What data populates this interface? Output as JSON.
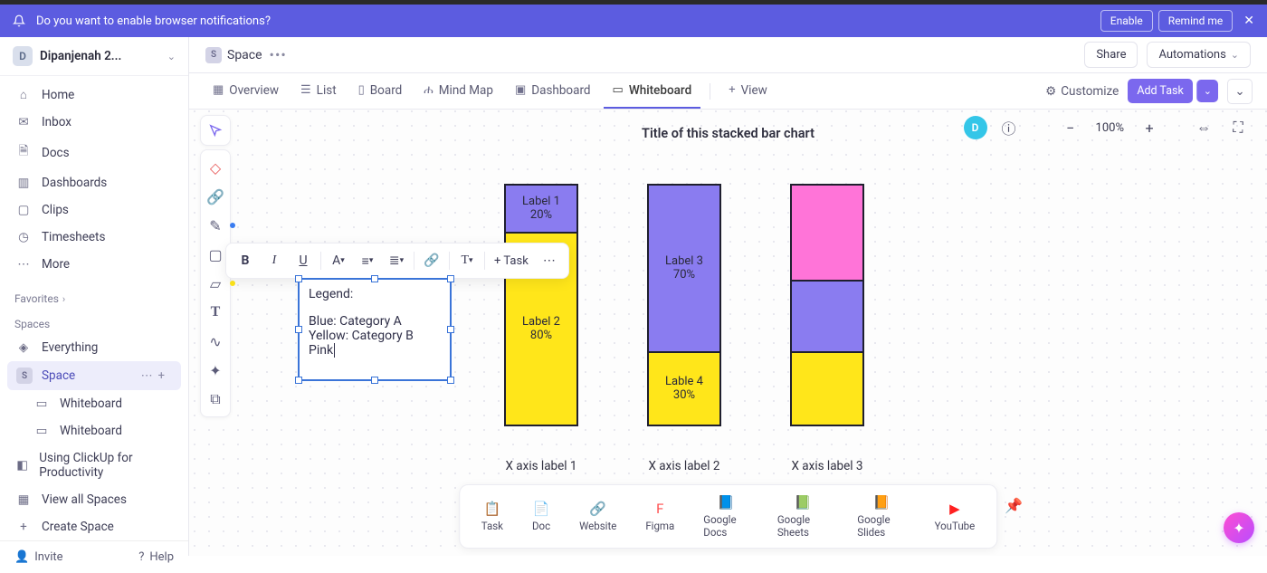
{
  "notification": {
    "message": "Do you want to enable browser notifications?",
    "enable": "Enable",
    "remind": "Remind me"
  },
  "workspace": {
    "initial": "D",
    "name": "Dipanjenah 2..."
  },
  "sidebar": {
    "items": [
      "Home",
      "Inbox",
      "Docs",
      "Dashboards",
      "Clips",
      "Timesheets",
      "More"
    ],
    "favorites": "Favorites",
    "spaces_label": "Spaces",
    "everything": "Everything",
    "space": "Space",
    "whiteboard1": "Whiteboard",
    "whiteboard2": "Whiteboard",
    "using": "Using ClickUp for Productivity",
    "view_all": "View all Spaces",
    "create": "Create Space",
    "invite": "Invite",
    "help": "Help"
  },
  "crumb": {
    "space": "Space",
    "share": "Share",
    "automations": "Automations"
  },
  "tabs": {
    "overview": "Overview",
    "list": "List",
    "board": "Board",
    "mindmap": "Mind Map",
    "dashboard": "Dashboard",
    "whiteboard": "Whiteboard",
    "view": "View",
    "customize": "Customize",
    "add_task": "Add Task"
  },
  "zoom": {
    "initial": "D",
    "pct": "100%"
  },
  "chart_data": {
    "type": "stacked-bar",
    "title": "Title of this stacked bar chart",
    "categories": [
      "X axis label 1",
      "X axis label 2",
      "X axis label 3"
    ],
    "bars": [
      {
        "segments": [
          {
            "label": "Label 1",
            "value": "20%",
            "pct": 20,
            "color": "#8a7cf0"
          },
          {
            "label": "Label 2",
            "value": "80%",
            "pct": 80,
            "color": "#ffe61a"
          }
        ]
      },
      {
        "segments": [
          {
            "label": "Label 3",
            "value": "70%",
            "pct": 70,
            "color": "#8a7cf0"
          },
          {
            "label": "Lable 4",
            "value": "30%",
            "pct": 30,
            "color": "#ffe61a"
          }
        ]
      },
      {
        "segments": [
          {
            "label": "",
            "value": "",
            "pct": 40,
            "color": "#ff74d8"
          },
          {
            "label": "",
            "value": "",
            "pct": 30,
            "color": "#8a7cf0"
          },
          {
            "label": "",
            "value": "",
            "pct": 30,
            "color": "#ffe61a"
          }
        ]
      }
    ]
  },
  "legend": {
    "title": "Legend:",
    "lines": [
      "Blue: Category A",
      "Yellow: Category B",
      "Pink"
    ]
  },
  "format_bar": {
    "task": "Task"
  },
  "dock": {
    "items": [
      "Task",
      "Doc",
      "Website",
      "Figma",
      "Google Docs",
      "Google Sheets",
      "Google Slides",
      "YouTube"
    ],
    "icons": [
      "📋",
      "📄",
      "🔗",
      "F",
      "📘",
      "📗",
      "📙",
      "▶"
    ],
    "colors": [
      "#5a5a74",
      "#5a5a74",
      "#5a5a74",
      "#ff4d4d",
      "#3a7cf0",
      "#1fa463",
      "#f0a020",
      "#ff2020"
    ]
  }
}
